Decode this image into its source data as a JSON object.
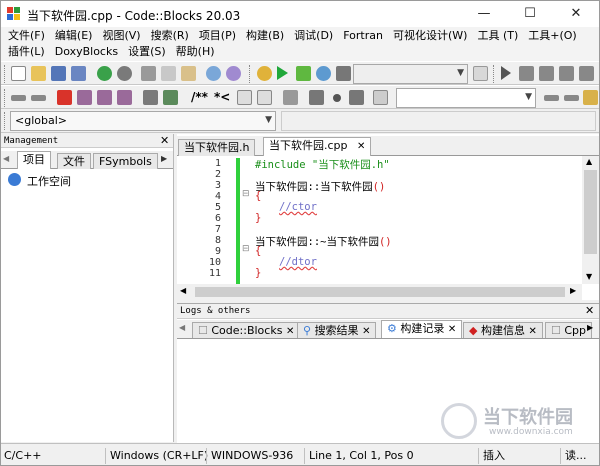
{
  "window": {
    "title": "当下软件园.cpp - Code::Blocks 20.03"
  },
  "window_controls": {
    "minimize": "—",
    "maximize": "☐",
    "close": "✕"
  },
  "menu": {
    "row1": [
      "文件(F)",
      "编辑(E)",
      "视图(V)",
      "搜索(R)",
      "项目(P)",
      "构建(B)",
      "调试(D)",
      "Fortran",
      "可视化设计(W)",
      "工具 (T)",
      "工具+(O)"
    ],
    "row2": [
      "插件(L)",
      "DoxyBlocks",
      "设置(S)",
      "帮助(H)"
    ]
  },
  "toolbar2": {
    "comment_block": "/**",
    "comment_line": "*<"
  },
  "scope": {
    "value": "<global>"
  },
  "management": {
    "title": "Management",
    "tabs": [
      "项目",
      "文件",
      "FSymbols"
    ],
    "tree_root": "工作空间"
  },
  "editor": {
    "tabs": [
      "当下软件园.h",
      "当下软件园.cpp"
    ],
    "line_numbers": [
      "1",
      "2",
      "3",
      "4",
      "5",
      "6",
      "7",
      "8",
      "9",
      "10",
      "11"
    ],
    "lines": [
      {
        "pre": "#include ",
        "str": "\"当下软件园.h\""
      },
      {
        "text": ""
      },
      {
        "text": "当下软件园::当下软件园",
        "paren": "()"
      },
      {
        "brace": "{"
      },
      {
        "comment": "//ctor"
      },
      {
        "brace": "}"
      },
      {
        "text": ""
      },
      {
        "text": "当下软件园::~当下软件园",
        "paren": "()"
      },
      {
        "brace": "{"
      },
      {
        "comment": "//dtor"
      },
      {
        "brace": "}"
      }
    ]
  },
  "logs": {
    "title": "Logs & others",
    "tabs": [
      "Code::Blocks",
      "搜索结果",
      "构建记录",
      "构建信息",
      "Cpp"
    ]
  },
  "status": {
    "lang": "C/C++",
    "eol": "Windows (CR+LF)",
    "encoding": "WINDOWS-936",
    "position": "Line 1, Col 1, Pos 0",
    "mode": "插入",
    "rw": "读..."
  },
  "watermark": {
    "name": "当下软件园",
    "url": "www.downxia.com"
  }
}
